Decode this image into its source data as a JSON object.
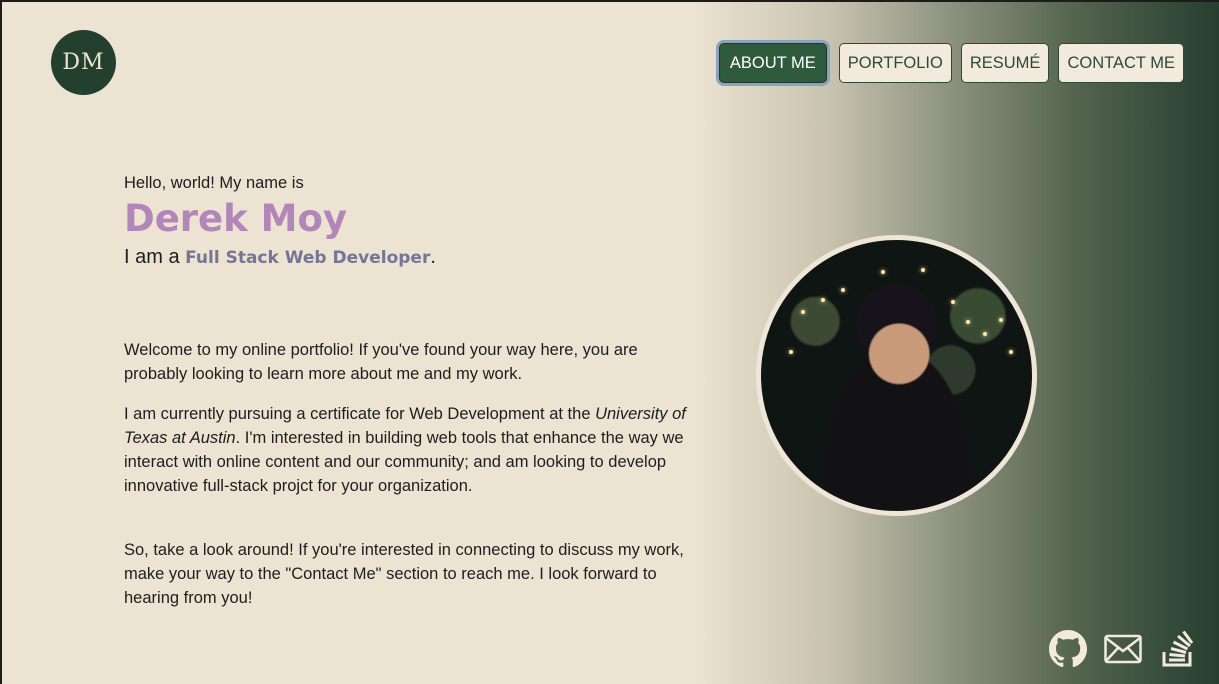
{
  "logo": {
    "initials": "DM"
  },
  "nav": {
    "items": [
      {
        "label": "ABOUT ME"
      },
      {
        "label": "PORTFOLIO"
      },
      {
        "label": "RESUMÉ"
      },
      {
        "label": "CONTACT ME"
      }
    ],
    "active": "ABOUT ME"
  },
  "hero": {
    "greeting": "Hello, world! My name is",
    "name": "Derek Moy",
    "role_prefix": "I am a ",
    "role_title": "Full Stack Web Developer",
    "role_suffix": "."
  },
  "about": {
    "p1": "Welcome to my online portfolio! If you've found your way here, you are probably looking to learn more about me and my work.",
    "p2_before": "I am currently pursuing a certificate for Web Development at the ",
    "p2_emphasis": "University of Texas at Austin",
    "p2_after": ". I'm interested in building web tools that enhance the way we interact with online content and our community; and am looking to develop innovative full-stack projct for your organization.",
    "p3": "So, take a look around! If you're interested in connecting to discuss my work, make your way to the \"Contact Me\" section to reach me. I look forward to hearing from you!"
  },
  "socials": {
    "icons": [
      "github-icon",
      "email-icon",
      "stackoverflow-icon"
    ]
  },
  "colors": {
    "accent_name": "#b386b9",
    "accent_title": "#757595",
    "brand_green": "#23402f",
    "background": "#ece3d2"
  }
}
